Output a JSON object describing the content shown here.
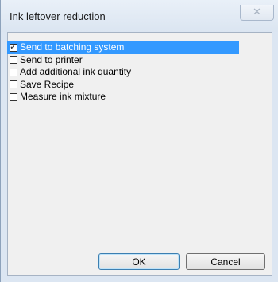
{
  "window": {
    "title": "Ink leftover reduction",
    "close_glyph": "✕"
  },
  "options": [
    {
      "label": "Send to batching system",
      "checked": true,
      "selected": true
    },
    {
      "label": "Send to printer",
      "checked": false,
      "selected": false
    },
    {
      "label": "Add additional ink quantity",
      "checked": false,
      "selected": false
    },
    {
      "label": "Save Recipe",
      "checked": false,
      "selected": false
    },
    {
      "label": "Measure ink mixture",
      "checked": false,
      "selected": false
    }
  ],
  "buttons": {
    "ok_label": "OK",
    "cancel_label": "Cancel"
  },
  "colors": {
    "selection": "#3399ff",
    "dialog_frame": "#dce6f2"
  },
  "icons": {
    "close": "close-icon",
    "check": "check-mark-icon"
  }
}
